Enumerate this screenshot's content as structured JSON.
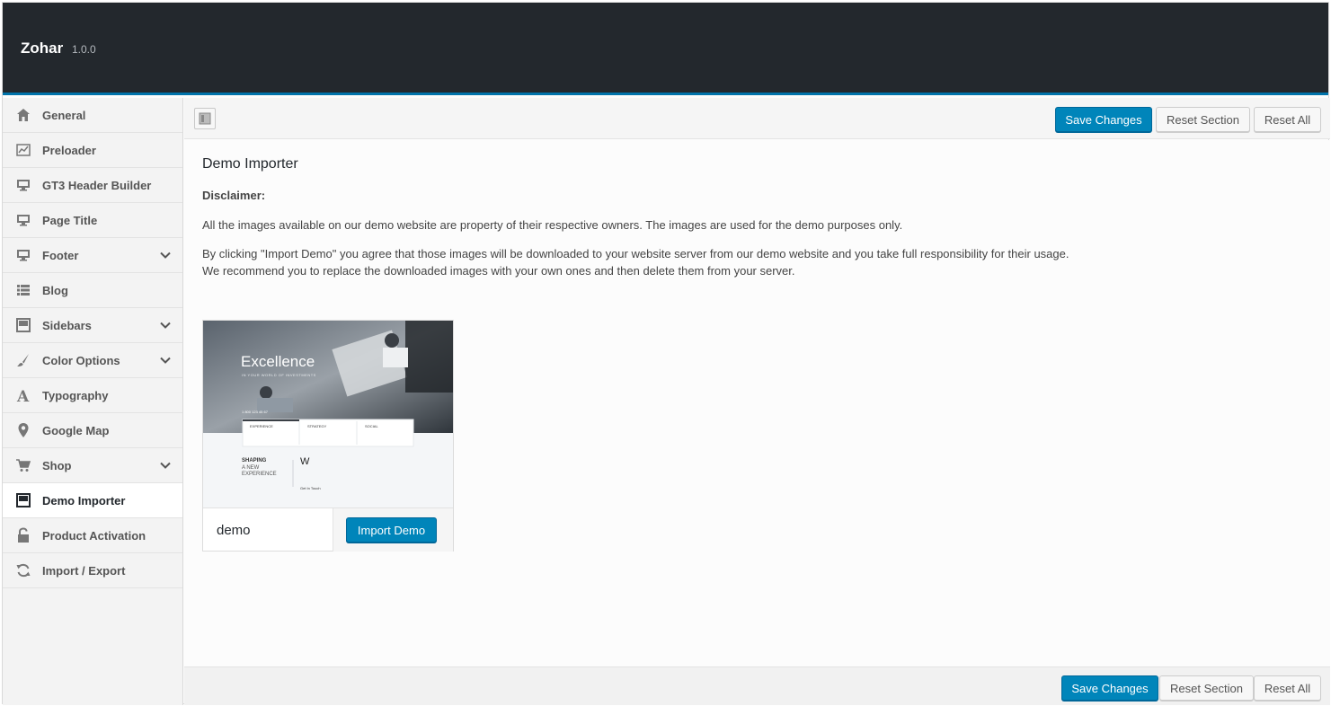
{
  "app": {
    "title": "Zohar",
    "version": "1.0.0"
  },
  "colors": {
    "header_bg": "#23282d",
    "accent": "#0073aa",
    "primary_button": "#0085ba"
  },
  "sidebar": {
    "items": [
      {
        "label": "General",
        "icon": "home-icon",
        "has_children": false,
        "active": false
      },
      {
        "label": "Preloader",
        "icon": "chart-icon",
        "has_children": false,
        "active": false
      },
      {
        "label": "GT3 Header Builder",
        "icon": "monitor-icon",
        "has_children": false,
        "active": false
      },
      {
        "label": "Page Title",
        "icon": "monitor-icon",
        "has_children": false,
        "active": false
      },
      {
        "label": "Footer",
        "icon": "monitor-icon",
        "has_children": true,
        "active": false
      },
      {
        "label": "Blog",
        "icon": "list-icon",
        "has_children": false,
        "active": false
      },
      {
        "label": "Sidebars",
        "icon": "layout-icon",
        "has_children": true,
        "active": false
      },
      {
        "label": "Color Options",
        "icon": "brush-icon",
        "has_children": true,
        "active": false
      },
      {
        "label": "Typography",
        "icon": "font-icon",
        "has_children": false,
        "active": false
      },
      {
        "label": "Google Map",
        "icon": "map-pin-icon",
        "has_children": false,
        "active": false
      },
      {
        "label": "Shop",
        "icon": "cart-icon",
        "has_children": true,
        "active": false
      },
      {
        "label": "Demo Importer",
        "icon": "layout-icon",
        "has_children": false,
        "active": true
      },
      {
        "label": "Product Activation",
        "icon": "unlock-icon",
        "has_children": false,
        "active": false
      },
      {
        "label": "Import / Export",
        "icon": "refresh-icon",
        "has_children": false,
        "active": false
      }
    ]
  },
  "toolbar": {
    "save_label": "Save Changes",
    "reset_section_label": "Reset Section",
    "reset_all_label": "Reset All"
  },
  "content": {
    "heading": "Demo Importer",
    "disclaimer_label": "Disclaimer:",
    "paragraph1": "All the images available on our demo website are property of their respective owners. The images are used for the demo purposes only.",
    "paragraph2_line1": "By clicking \"Import Demo\" you agree that those images will be downloaded to your website server from our demo website and you take full responsibility for their usage.",
    "paragraph2_line2": "We recommend you to replace the downloaded images with your own ones and then delete them from your server.",
    "demo": {
      "name": "demo",
      "import_label": "Import Demo",
      "preview": {
        "hero_title": "Excellence",
        "hero_subtitle": "IN YOUR WORLD OF INVESTMENTS",
        "phone": "1 800 123 45 67",
        "columns": [
          "EXPERIENCE",
          "STRATEGY",
          "SOCIAL"
        ],
        "shaping_line1": "SHAPING",
        "shaping_line2": "A NEW",
        "shaping_line3": "EXPERIENCE",
        "drop_cap": "W",
        "get_in_touch": "Get In Touch"
      }
    }
  }
}
